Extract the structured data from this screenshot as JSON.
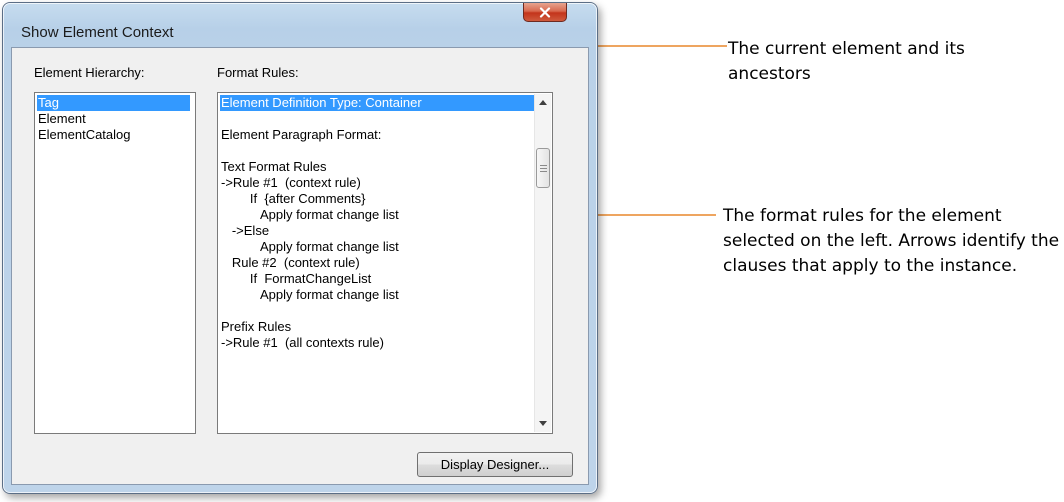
{
  "window": {
    "title": "Show Element Context",
    "close_glyph": "x"
  },
  "hierarchy": {
    "label": "Element Hierarchy:",
    "items": [
      "Tag",
      "Element",
      "ElementCatalog"
    ],
    "selected_index": 0
  },
  "rules": {
    "label": "Format Rules:",
    "lines": [
      "Element Definition Type: Container",
      "",
      "Element Paragraph Format:",
      "",
      "Text Format Rules",
      "->Rule #1  (context rule)",
      "        If  {after Comments}",
      "           Apply format change list",
      "   ->Else",
      "           Apply format change list",
      "   Rule #2  (context rule)",
      "        If  FormatChangeList",
      "           Apply format change list",
      "",
      "Prefix Rules",
      "->Rule #1  (all contexts rule)"
    ],
    "selected_index": 0
  },
  "buttons": {
    "display_designer": "Display Designer..."
  },
  "callouts": {
    "ancestors": "The current element and its ancestors",
    "format_rules": "The format rules for the element selected on the left. Arrows identify the clauses that apply to the instance."
  },
  "colors": {
    "selection": "#3399ff",
    "callout_line": "#e8872b",
    "dialog_face": "#f0f0f0",
    "frame": "#bed4ea"
  }
}
